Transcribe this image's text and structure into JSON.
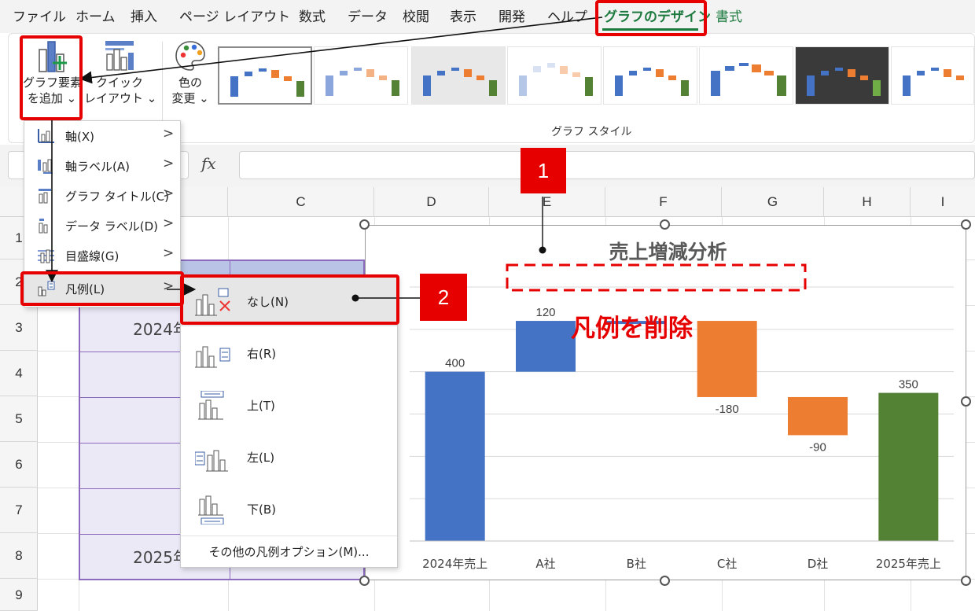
{
  "menu": {
    "tabs": [
      "ファイル",
      "ホーム",
      "挿入",
      "ページ レイアウト",
      "数式",
      "データ",
      "校閲",
      "表示",
      "開発",
      "ヘルプ",
      "グラフのデザイン",
      "書式"
    ],
    "active": "グラフのデザイン"
  },
  "ribbon": {
    "add_element": {
      "line1": "グラフ要素",
      "line2": "を追加 ⌄"
    },
    "quick_layout": {
      "line1": "クイック",
      "line2": "レイアウト ⌄"
    },
    "change_colors": {
      "line1": "色の",
      "line2": "変更 ⌄"
    },
    "gallery_label": "グラフ スタイル"
  },
  "formula_bar": {
    "fx": "fx"
  },
  "grid": {
    "columns": [
      "C",
      "D",
      "E",
      "F",
      "G",
      "H",
      "I"
    ],
    "rows": [
      "1",
      "2",
      "3",
      "4",
      "5",
      "6",
      "7",
      "8",
      "9"
    ],
    "cells": [
      "2024年売上",
      "A社",
      "B社",
      "C社",
      "D社",
      "2025年売上"
    ]
  },
  "dropdown": {
    "items": [
      "軸(X)",
      "軸ラベル(A)",
      "グラフ タイトル(C)",
      "データ ラベル(D)",
      "目盛線(G)",
      "凡例(L)"
    ],
    "chevron": ">"
  },
  "legend_submenu": {
    "items": [
      "なし(N)",
      "右(R)",
      "上(T)",
      "左(L)",
      "下(B)"
    ],
    "more": "その他の凡例オプション(M)..."
  },
  "annotations": {
    "badge1": "1",
    "badge2": "2",
    "caption": "凡例を削除"
  },
  "chart_data": {
    "type": "bar",
    "subtype": "waterfall",
    "title": "売上増減分析",
    "categories": [
      "2024年売上",
      "A社",
      "B社",
      "C社",
      "D社",
      "2025年売上"
    ],
    "values": [
      400,
      120,
      0,
      -180,
      -90,
      350
    ],
    "data_labels": [
      "400",
      "120",
      "",
      "-180",
      "-90",
      "350"
    ],
    "kinds": [
      "total",
      "increase",
      "increase",
      "decrease",
      "decrease",
      "total"
    ],
    "colors": {
      "total_start": "#4472C4",
      "increase": "#4472C4",
      "decrease": "#ED7D31",
      "total_end": "#548235"
    },
    "ylim": [
      0,
      600
    ],
    "grid": true,
    "legend": "none"
  }
}
